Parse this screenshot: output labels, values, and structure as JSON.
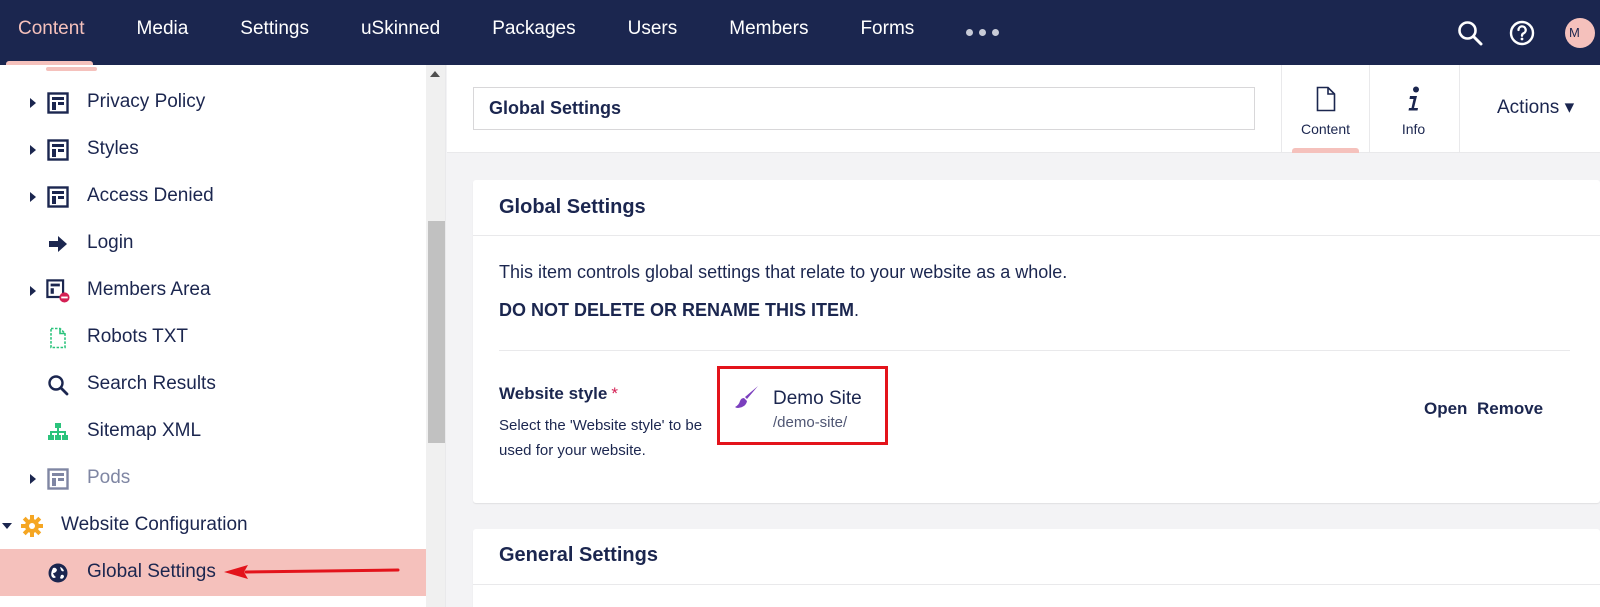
{
  "topnav": {
    "items": [
      {
        "label": "Content",
        "active": true
      },
      {
        "label": "Media"
      },
      {
        "label": "Settings"
      },
      {
        "label": "uSkinned"
      },
      {
        "label": "Packages"
      },
      {
        "label": "Users"
      },
      {
        "label": "Members"
      },
      {
        "label": "Forms"
      }
    ],
    "more_icon": "ellipsis-icon",
    "search_icon": "search-icon",
    "help_icon": "help-icon",
    "avatar_initial": "M"
  },
  "sidebar": {
    "items": [
      {
        "label": "Privacy Policy",
        "icon": "page-layout-icon",
        "has_children": true
      },
      {
        "label": "Styles",
        "icon": "page-layout-icon",
        "has_children": true
      },
      {
        "label": "Access Denied",
        "icon": "page-layout-icon",
        "has_children": true
      },
      {
        "label": "Login",
        "icon": "arrow-right-icon",
        "has_children": false
      },
      {
        "label": "Members Area",
        "icon": "protected-page-icon",
        "has_children": true
      },
      {
        "label": "Robots TXT",
        "icon": "document-icon",
        "has_children": false
      },
      {
        "label": "Search Results",
        "icon": "search-icon",
        "has_children": false
      },
      {
        "label": "Sitemap XML",
        "icon": "sitemap-icon",
        "has_children": false
      },
      {
        "label": "Pods",
        "icon": "page-layout-icon",
        "has_children": true,
        "muted": true
      },
      {
        "label": "Website Configuration",
        "icon": "gear-icon",
        "expanded": true
      },
      {
        "label": "Global Settings",
        "icon": "globe-icon",
        "selected": true
      }
    ]
  },
  "header": {
    "node_name": "Global Settings",
    "tabs": [
      {
        "label": "Content",
        "icon": "document-icon",
        "active": true
      },
      {
        "label": "Info",
        "icon": "info-icon"
      }
    ],
    "actions_label": "Actions"
  },
  "global_settings_panel": {
    "title": "Global Settings",
    "description": "This item controls global settings that relate to your website as a whole.",
    "warning": "DO NOT DELETE OR RENAME THIS ITEM",
    "warning_suffix": ".",
    "property": {
      "label": "Website style",
      "required_mark": "*",
      "description": "Select the 'Website style' to be used for your website.",
      "picked_name": "Demo Site",
      "picked_url": "/demo-site/",
      "picked_icon": "paintbrush-icon",
      "open_label": "Open",
      "remove_label": "Remove"
    }
  },
  "general_settings_panel": {
    "title": "General Settings"
  },
  "colors": {
    "topbar": "#1b264f",
    "accent": "#f5c1bc",
    "highlight_border": "#e3131b",
    "annotation_arrow": "#e3131b",
    "required": "#d42054",
    "brush": "#7b3fbe",
    "gear": "#f5a623",
    "sitemap": "#2bc37c"
  }
}
